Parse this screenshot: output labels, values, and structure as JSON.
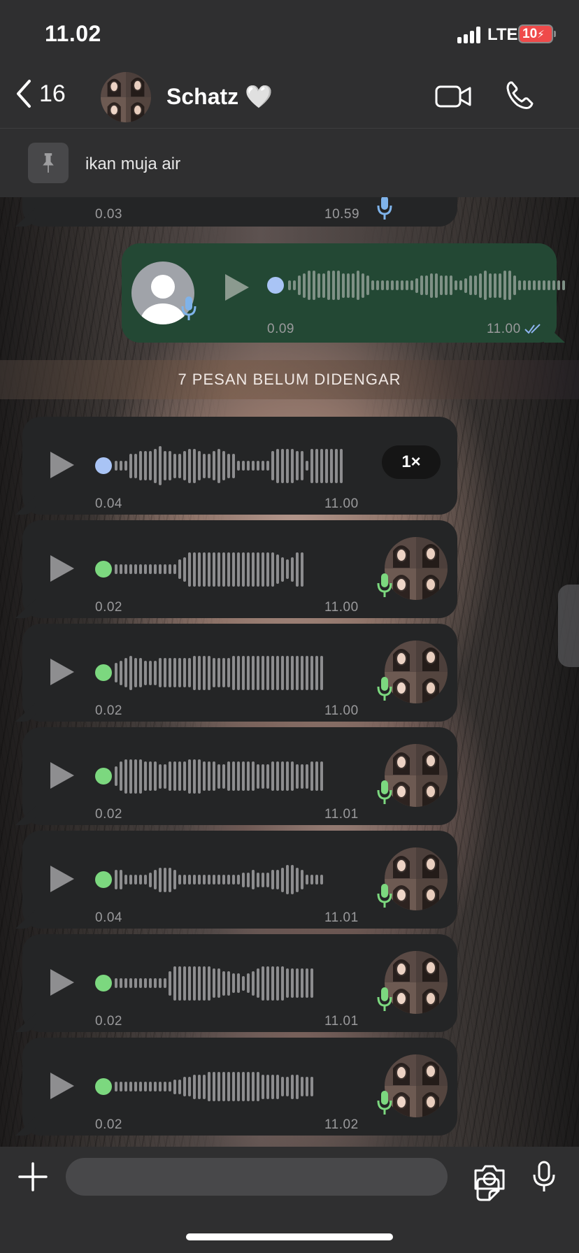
{
  "status_bar": {
    "time": "11.02",
    "carrier": "LTE",
    "battery": "10"
  },
  "header": {
    "back_count": "16",
    "contact_name": "Schatz 🤍"
  },
  "pinned": {
    "text": "ikan muja air"
  },
  "partial_message": {
    "duration": "0.03",
    "time": "10.59"
  },
  "outgoing_message": {
    "duration": "0.09",
    "time": "11.00"
  },
  "unread_banner": "7 PESAN BELUM DIDENGAR",
  "voice_messages": [
    {
      "duration": "0.04",
      "time": "11.00",
      "speed": "1×",
      "state": "played"
    },
    {
      "duration": "0.02",
      "time": "11.00",
      "state": "unplayed"
    },
    {
      "duration": "0.02",
      "time": "11.00",
      "state": "unplayed"
    },
    {
      "duration": "0.02",
      "time": "11.01",
      "state": "unplayed"
    },
    {
      "duration": "0.04",
      "time": "11.01",
      "state": "unplayed"
    },
    {
      "duration": "0.02",
      "time": "11.01",
      "state": "unplayed"
    },
    {
      "duration": "0.02",
      "time": "11.02",
      "state": "unplayed"
    }
  ],
  "colors": {
    "played_dot": "#a9c4f5",
    "unplayed_dot": "#7cd87f",
    "outgoing_bubble": "#234834",
    "incoming_bubble": "#242526",
    "read_ticks": "#8fb4f0"
  }
}
